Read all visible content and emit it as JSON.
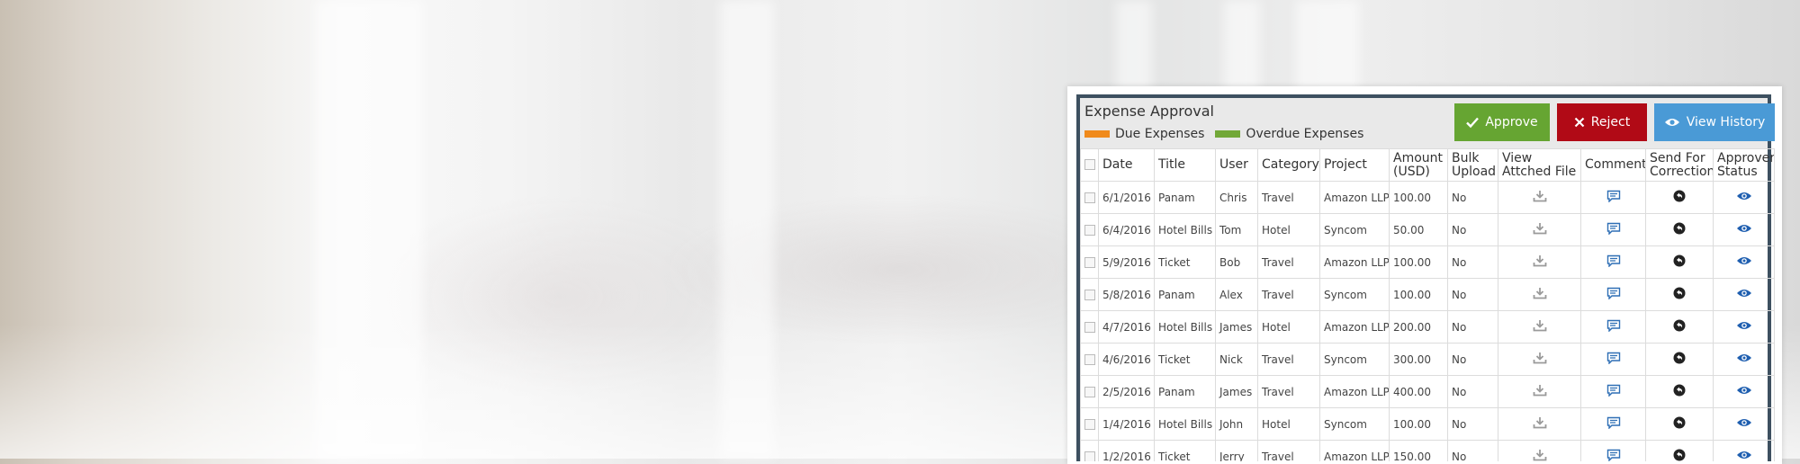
{
  "panel": {
    "title": "Expense Approval",
    "legend": [
      {
        "label": "Due Expenses",
        "color": "#f08a1c"
      },
      {
        "label": "Overdue Expenses",
        "color": "#72a838"
      }
    ],
    "buttons": {
      "approve": {
        "label": "Approve",
        "color": "#66a532"
      },
      "reject": {
        "label": "Reject",
        "color": "#b10a16"
      },
      "history": {
        "label": "View History",
        "color": "#4a9ad6"
      }
    }
  },
  "table": {
    "columns": [
      "Date",
      "Title",
      "User",
      "Category",
      "Project",
      "Amount (USD)",
      "Bulk Upload",
      "View Attched File",
      "Comment",
      "Send For Correction",
      "Approver Status"
    ],
    "rows": [
      {
        "date": "6/1/2016",
        "title": "Panam",
        "user": "Chris",
        "category": "Travel",
        "project": "Amazon LLP",
        "amount": "100.00",
        "bulk": "No"
      },
      {
        "date": "6/4/2016",
        "title": "Hotel Bills",
        "user": "Tom",
        "category": "Hotel",
        "project": "Syncom",
        "amount": "50.00",
        "bulk": "No"
      },
      {
        "date": "5/9/2016",
        "title": "Ticket",
        "user": "Bob",
        "category": "Travel",
        "project": "Amazon LLP",
        "amount": "100.00",
        "bulk": "No"
      },
      {
        "date": "5/8/2016",
        "title": "Panam",
        "user": "Alex",
        "category": "Travel",
        "project": "Syncom",
        "amount": "100.00",
        "bulk": "No"
      },
      {
        "date": "4/7/2016",
        "title": "Hotel Bills",
        "user": "James",
        "category": "Hotel",
        "project": "Amazon LLP",
        "amount": "200.00",
        "bulk": "No"
      },
      {
        "date": "4/6/2016",
        "title": "Ticket",
        "user": "Nick",
        "category": "Travel",
        "project": "Syncom",
        "amount": "300.00",
        "bulk": "No"
      },
      {
        "date": "2/5/2016",
        "title": "Panam",
        "user": "James",
        "category": "Travel",
        "project": "Amazon LLP",
        "amount": "400.00",
        "bulk": "No"
      },
      {
        "date": "1/4/2016",
        "title": "Hotel Bills",
        "user": "John",
        "category": "Hotel",
        "project": "Syncom",
        "amount": "100.00",
        "bulk": "No"
      },
      {
        "date": "1/2/2016",
        "title": "Ticket",
        "user": "Jerry",
        "category": "Travel",
        "project": "Amazon LLP",
        "amount": "150.00",
        "bulk": "No"
      }
    ],
    "icons": {
      "file": "download-icon",
      "comment": "comment-icon",
      "correction": "send-back-icon",
      "status": "eye-icon"
    },
    "icon_colors": {
      "file": "#9a9a9a",
      "comment": "#2f6fb5",
      "correction": "#222222",
      "status": "#1f5fb0"
    }
  }
}
